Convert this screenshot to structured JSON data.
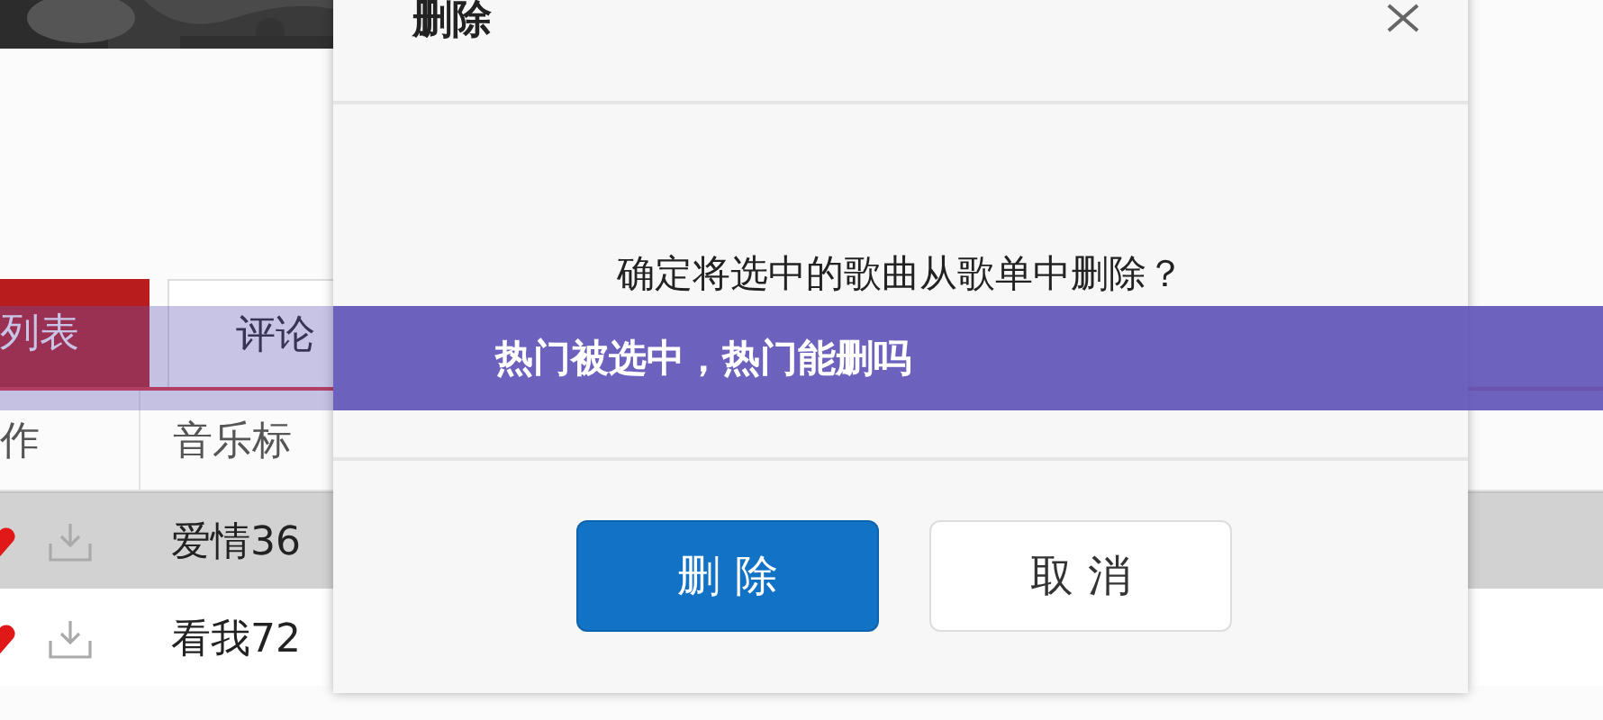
{
  "background_app": {
    "tabs": [
      {
        "label": "列表",
        "selected": true
      },
      {
        "label": "评论",
        "selected": false
      }
    ],
    "table": {
      "columns": [
        "作",
        "音乐标"
      ],
      "rows": [
        {
          "title": "爱情36",
          "liked": true,
          "selected": true
        },
        {
          "title": "看我72",
          "liked": true,
          "selected": false
        }
      ]
    }
  },
  "dialog": {
    "title": "删除",
    "message": "确定将选中的歌曲从歌单中删除？",
    "buttons": [
      {
        "label": "删 除",
        "kind": "primary"
      },
      {
        "label": "取 消",
        "kind": "secondary"
      }
    ]
  },
  "banner": {
    "text": "热门被选中，热门能删吗"
  }
}
